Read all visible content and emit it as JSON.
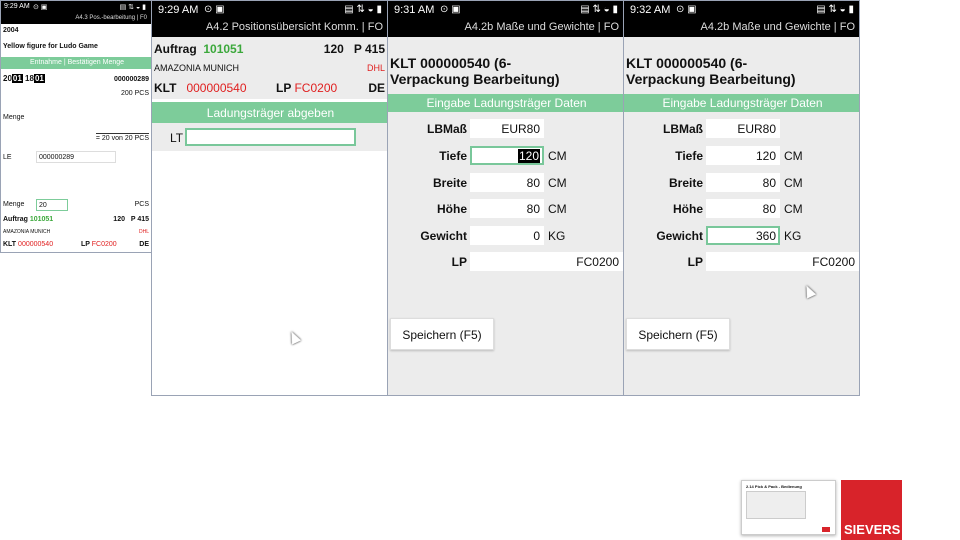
{
  "screen1": {
    "time": "9:29 AM",
    "title": "A4.3 Pos.-bearbeitung | F0",
    "year": "2004",
    "article": "Yellow figure for Ludo Game",
    "bar": "Entnahme | Bestätigen Menge",
    "date_parts": [
      "20",
      "01",
      "18",
      "01"
    ],
    "code": "000000289",
    "pcs": "200 PCS",
    "menge_label": "Menge",
    "progress": "= 20 von 20 PCS",
    "le_label": "LE",
    "le_value": "000000289",
    "menge2_label": "Menge",
    "menge2_value": "20",
    "menge2_unit": "PCS",
    "auftrag_label": "Auftrag",
    "auftrag_value": "101051",
    "qty": "120",
    "pos": "P 415",
    "customer": "AMAZONIA MUNICH",
    "carrier": "DHL",
    "klt_label": "KLT",
    "klt_value": "000000540",
    "lp_label": "LP",
    "lp_value": "FC0200",
    "de": "DE"
  },
  "screen2": {
    "time": "9:29 AM",
    "title": "A4.2 Positionsübersicht Komm. | FO",
    "auftrag_label": "Auftrag",
    "auftrag_value": "101051",
    "qty": "120",
    "pos": "P 415",
    "customer": "AMAZONIA MUNICH",
    "carrier": "DHL",
    "klt_label": "KLT",
    "klt_value": "000000540",
    "lp_label": "LP",
    "lp_value": "FC0200",
    "de": "DE",
    "bar": "Ladungsträger abgeben",
    "lt_label": "LT",
    "lt_value": ""
  },
  "screen3": {
    "time": "9:31 AM",
    "title": "A4.2b Maße und Gewichte | FO",
    "klt_title": "KLT 000000540 (6-Verpackung Bearbeitung)",
    "bar": "Eingabe Ladungsträger Daten",
    "lbmass_label": "LBMaß",
    "lbmass_value": "EUR80",
    "tiefe_label": "Tiefe",
    "tiefe_value": "120",
    "tiefe_unit": "CM",
    "breite_label": "Breite",
    "breite_value": "80",
    "breite_unit": "CM",
    "hoehe_label": "Höhe",
    "hoehe_value": "80",
    "hoehe_unit": "CM",
    "gewicht_label": "Gewicht",
    "gewicht_value": "0",
    "gewicht_unit": "KG",
    "lp_label": "LP",
    "lp_value": "FC0200",
    "save": "Speichern (F5)"
  },
  "screen4": {
    "time": "9:32 AM",
    "title": "A4.2b Maße und Gewichte | FO",
    "klt_title": "KLT 000000540 (6-Verpackung Bearbeitung)",
    "bar": "Eingabe Ladungsträger Daten",
    "lbmass_label": "LBMaß",
    "lbmass_value": "EUR80",
    "tiefe_label": "Tiefe",
    "tiefe_value": "120",
    "tiefe_unit": "CM",
    "breite_label": "Breite",
    "breite_value": "80",
    "breite_unit": "CM",
    "hoehe_label": "Höhe",
    "hoehe_value": "80",
    "hoehe_unit": "CM",
    "gewicht_label": "Gewicht",
    "gewicht_value": "360",
    "gewicht_unit": "KG",
    "lp_label": "LP",
    "lp_value": "FC0200",
    "save": "Speichern (F5)"
  },
  "branding": {
    "logo_text": "SIEVERS",
    "logo_color": "#d8232a",
    "thumb_title": "2.14 Pick & Pack - Bedienung"
  },
  "colors": {
    "accent_green": "#7dcc9a",
    "alert_red": "#e02020",
    "value_green": "#3ba83b"
  }
}
